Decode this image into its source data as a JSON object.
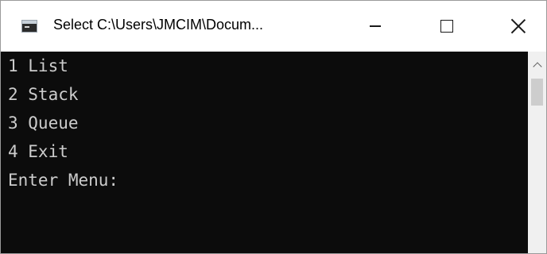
{
  "window": {
    "title": "Select C:\\Users\\JMCIM\\Docum..."
  },
  "console": {
    "lines": [
      "1 List",
      "2 Stack",
      "3 Queue",
      "4 Exit",
      "Enter Menu:"
    ]
  },
  "colors": {
    "console_background": "#0c0c0c",
    "console_text": "#cccccc",
    "titlebar_background": "#ffffff"
  },
  "icons": {
    "app": "console-app-icon",
    "minimize": "minimize-icon",
    "maximize": "maximize-icon",
    "close": "close-icon",
    "scroll_up": "chevron-up-icon"
  }
}
